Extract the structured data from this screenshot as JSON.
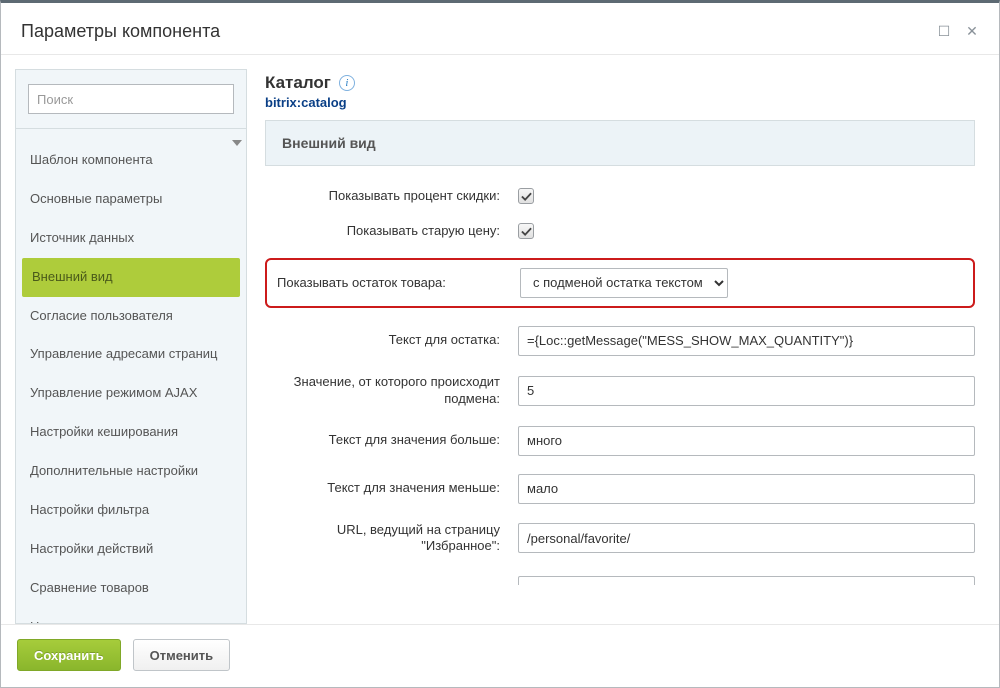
{
  "header": {
    "title": "Параметры компонента"
  },
  "sidebar": {
    "search_placeholder": "Поиск",
    "items": [
      {
        "label": "Шаблон компонента",
        "active": false
      },
      {
        "label": "Основные параметры",
        "active": false
      },
      {
        "label": "Источник данных",
        "active": false
      },
      {
        "label": "Внешний вид",
        "active": true
      },
      {
        "label": "Согласие пользователя",
        "active": false
      },
      {
        "label": "Управление адресами страниц",
        "active": false
      },
      {
        "label": "Управление режимом AJAX",
        "active": false
      },
      {
        "label": "Настройки кеширования",
        "active": false
      },
      {
        "label": "Дополнительные настройки",
        "active": false
      },
      {
        "label": "Настройки фильтра",
        "active": false
      },
      {
        "label": "Настройки действий",
        "active": false
      },
      {
        "label": "Сравнение товаров",
        "active": false
      },
      {
        "label": "Цены",
        "active": false
      }
    ]
  },
  "main": {
    "title": "Каталог",
    "code": "bitrix:catalog",
    "section": "Внешний вид",
    "rows": {
      "discount_label": "Показывать процент скидки:",
      "discount_checked": true,
      "oldprice_label": "Показывать старую цену:",
      "oldprice_checked": true,
      "stock_label": "Показывать остаток товара:",
      "stock_option": "с подменой остатка текстом",
      "stock_text_label": "Текст для остатка:",
      "stock_text_value": "={Loc::getMessage(\"MESS_SHOW_MAX_QUANTITY\")}",
      "threshold_label": "Значение, от которого происходит подмена:",
      "threshold_value": "5",
      "more_label": "Текст для значения больше:",
      "more_value": "много",
      "less_label": "Текст для значения меньше:",
      "less_value": "мало",
      "favorite_label": "URL, ведущий на страницу \"Избранное\":",
      "favorite_value": "/personal/favorite/"
    }
  },
  "footer": {
    "save": "Сохранить",
    "cancel": "Отменить"
  }
}
